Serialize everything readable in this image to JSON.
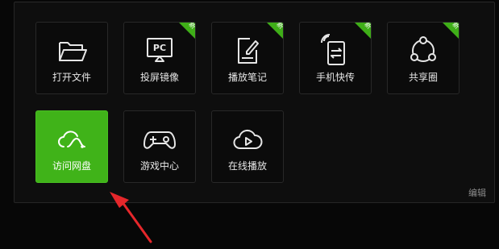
{
  "tiles": [
    {
      "label": "打开文件",
      "icon": "folder-icon",
      "badge": ""
    },
    {
      "label": "投屏镜像",
      "icon": "pc-cast-icon",
      "badge": "新",
      "icon_text": "PC"
    },
    {
      "label": "播放笔记",
      "icon": "note-edit-icon",
      "badge": "新"
    },
    {
      "label": "手机快传",
      "icon": "phone-transfer-icon",
      "badge": "新"
    },
    {
      "label": "共享圈",
      "icon": "share-circle-icon",
      "badge": "新"
    },
    {
      "label": "访问网盘",
      "icon": "cloud-drive-icon",
      "badge": "",
      "active": true
    },
    {
      "label": "游戏中心",
      "icon": "gamepad-icon",
      "badge": ""
    },
    {
      "label": "在线播放",
      "icon": "cloud-play-icon",
      "badge": ""
    }
  ],
  "edit_label": "编辑",
  "colors": {
    "accent": "#40b319",
    "badge": "#3fae18",
    "arrow": "#e5272b"
  }
}
